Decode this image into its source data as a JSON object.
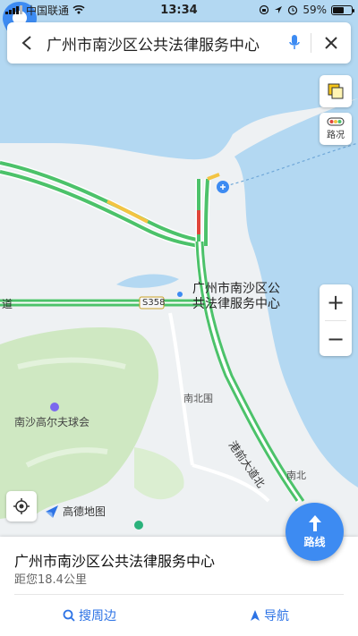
{
  "status_bar": {
    "carrier": "中国联通",
    "time": "13:34",
    "battery_percent": "59%",
    "battery_level": 0.59
  },
  "search": {
    "title": "广州市南沙区公共法律服务中心",
    "back_icon": "back-arrow-icon",
    "mic_icon": "microphone-icon",
    "close_icon": "close-icon"
  },
  "map": {
    "pin_label_line1": "广州市南沙区公",
    "pin_label_line2": "共法律服务中心",
    "road_badge": "S358",
    "road_left": "道",
    "area_golf": "南沙高尔夫球会",
    "area_nanbeiwei": "南北围",
    "road_diagonal": "港前大道北",
    "area_nanbei": "南北",
    "logo_text": "高德地图",
    "colors": {
      "water": "#b3d8f2",
      "land": "#eef1f3",
      "green": "#cfe8c2",
      "road_green": "#4cc26a",
      "road_yellow": "#f3c443",
      "road_red": "#e0463a",
      "accent": "#3d8bf2"
    }
  },
  "tools": {
    "layers_icon": "layers-icon",
    "traffic_icon": "traffic-light-icon",
    "traffic_label": "路况",
    "zoom_in": "+",
    "zoom_out": "−",
    "locate_icon": "locate-icon"
  },
  "route_button": {
    "label": "路线",
    "icon": "route-arrow-icon"
  },
  "place_card": {
    "title": "广州市南沙区公共法律服务中心",
    "distance": "距您18.4公里",
    "nearby_label": "搜周边",
    "navigate_label": "导航"
  }
}
